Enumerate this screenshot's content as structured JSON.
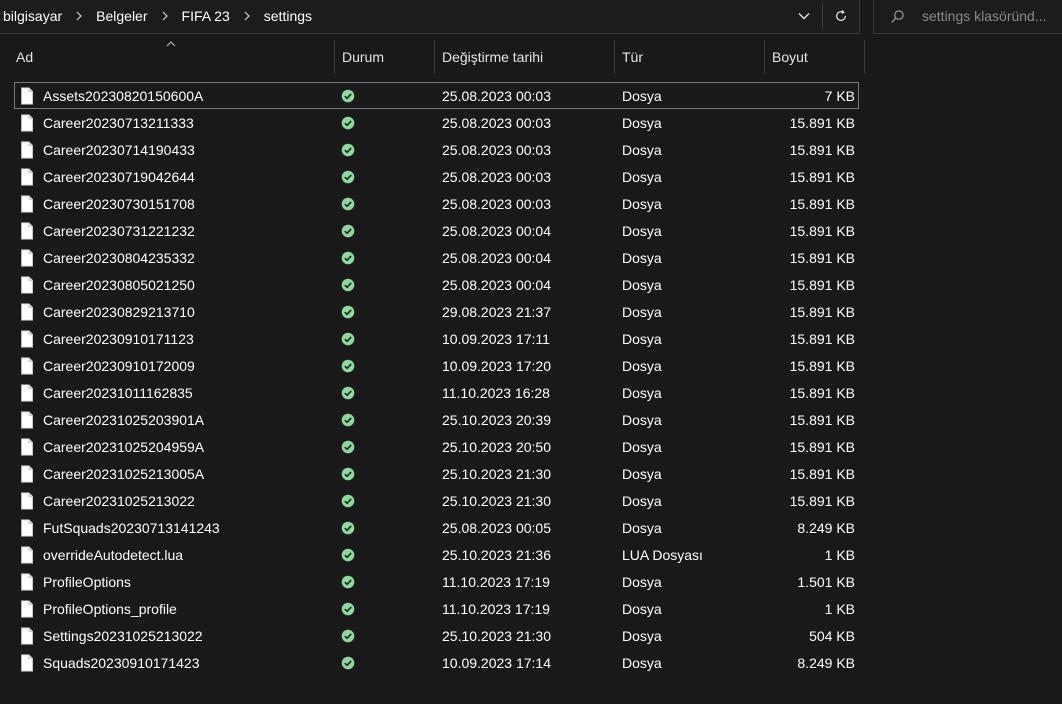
{
  "breadcrumbs": [
    "bilgisayar",
    "Belgeler",
    "FIFA 23",
    "settings"
  ],
  "search": {
    "placeholder": "settings klasöründ..."
  },
  "columns": {
    "name": "Ad",
    "status": "Durum",
    "modified": "Değiştirme tarihi",
    "type": "Tür",
    "size": "Boyut"
  },
  "icons": {
    "file": "file-icon",
    "status": "synced-check-icon",
    "chevron": "chevron-down-icon",
    "refresh": "refresh-icon",
    "search": "search-icon"
  },
  "colors": {
    "sync_ok": "#8fd6a0",
    "background": "#191919",
    "selection_border": "#767676"
  },
  "files": [
    {
      "name": "Assets20230820150600A",
      "modified": "25.08.2023 00:03",
      "type": "Dosya",
      "size": "7 KB",
      "selected": true
    },
    {
      "name": "Career20230713211333",
      "modified": "25.08.2023 00:03",
      "type": "Dosya",
      "size": "15.891 KB"
    },
    {
      "name": "Career20230714190433",
      "modified": "25.08.2023 00:03",
      "type": "Dosya",
      "size": "15.891 KB"
    },
    {
      "name": "Career20230719042644",
      "modified": "25.08.2023 00:03",
      "type": "Dosya",
      "size": "15.891 KB"
    },
    {
      "name": "Career20230730151708",
      "modified": "25.08.2023 00:03",
      "type": "Dosya",
      "size": "15.891 KB"
    },
    {
      "name": "Career20230731221232",
      "modified": "25.08.2023 00:04",
      "type": "Dosya",
      "size": "15.891 KB"
    },
    {
      "name": "Career20230804235332",
      "modified": "25.08.2023 00:04",
      "type": "Dosya",
      "size": "15.891 KB"
    },
    {
      "name": "Career20230805021250",
      "modified": "25.08.2023 00:04",
      "type": "Dosya",
      "size": "15.891 KB"
    },
    {
      "name": "Career20230829213710",
      "modified": "29.08.2023 21:37",
      "type": "Dosya",
      "size": "15.891 KB"
    },
    {
      "name": "Career20230910171123",
      "modified": "10.09.2023 17:11",
      "type": "Dosya",
      "size": "15.891 KB"
    },
    {
      "name": "Career20230910172009",
      "modified": "10.09.2023 17:20",
      "type": "Dosya",
      "size": "15.891 KB"
    },
    {
      "name": "Career20231011162835",
      "modified": "11.10.2023 16:28",
      "type": "Dosya",
      "size": "15.891 KB"
    },
    {
      "name": "Career20231025203901A",
      "modified": "25.10.2023 20:39",
      "type": "Dosya",
      "size": "15.891 KB"
    },
    {
      "name": "Career20231025204959A",
      "modified": "25.10.2023 20:50",
      "type": "Dosya",
      "size": "15.891 KB"
    },
    {
      "name": "Career20231025213005A",
      "modified": "25.10.2023 21:30",
      "type": "Dosya",
      "size": "15.891 KB"
    },
    {
      "name": "Career20231025213022",
      "modified": "25.10.2023 21:30",
      "type": "Dosya",
      "size": "15.891 KB"
    },
    {
      "name": "FutSquads20230713141243",
      "modified": "25.08.2023 00:05",
      "type": "Dosya",
      "size": "8.249 KB"
    },
    {
      "name": "overrideAutodetect.lua",
      "modified": "25.10.2023 21:36",
      "type": "LUA Dosyası",
      "size": "1 KB"
    },
    {
      "name": "ProfileOptions",
      "modified": "11.10.2023 17:19",
      "type": "Dosya",
      "size": "1.501 KB"
    },
    {
      "name": "ProfileOptions_profile",
      "modified": "11.10.2023 17:19",
      "type": "Dosya",
      "size": "1 KB"
    },
    {
      "name": "Settings20231025213022",
      "modified": "25.10.2023 21:30",
      "type": "Dosya",
      "size": "504 KB"
    },
    {
      "name": "Squads20230910171423",
      "modified": "10.09.2023 17:14",
      "type": "Dosya",
      "size": "8.249 KB"
    }
  ]
}
